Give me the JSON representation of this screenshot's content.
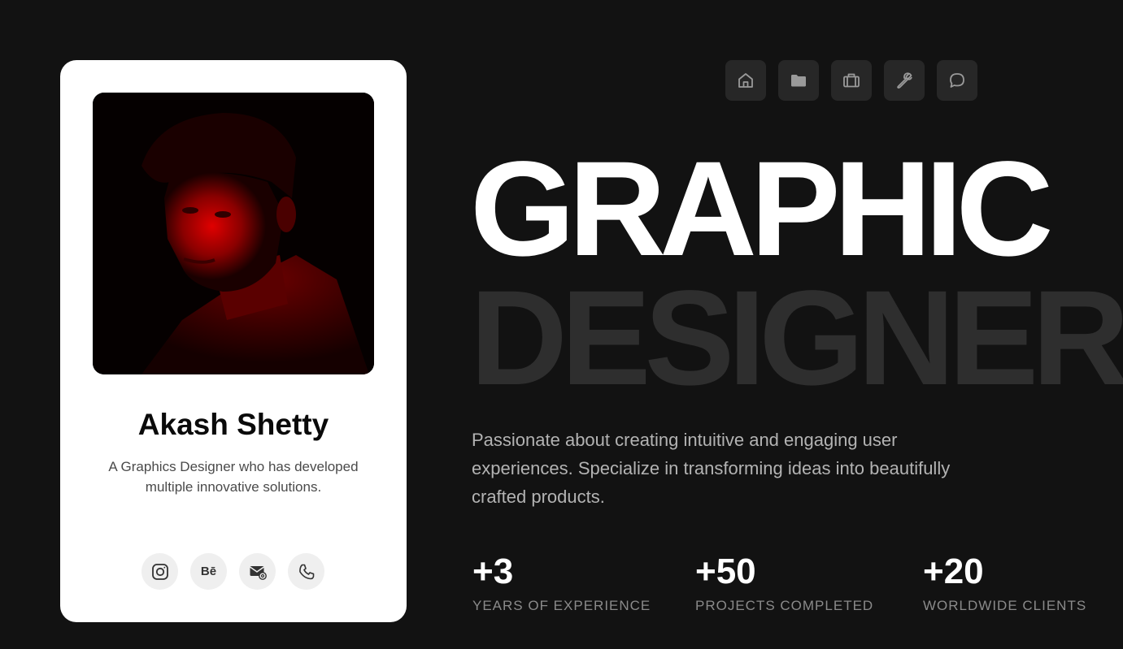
{
  "profile": {
    "name": "Akash Shetty",
    "bio": "A Graphics Designer who has developed multiple innovative solutions.",
    "socials": [
      {
        "icon": "instagram-icon"
      },
      {
        "icon": "behance-icon",
        "label": "Bē"
      },
      {
        "icon": "mail-icon"
      },
      {
        "icon": "phone-icon"
      }
    ]
  },
  "nav": {
    "items": [
      {
        "icon": "home-icon"
      },
      {
        "icon": "folder-icon"
      },
      {
        "icon": "briefcase-icon"
      },
      {
        "icon": "wrench-icon"
      },
      {
        "icon": "chat-icon"
      }
    ]
  },
  "hero": {
    "line1": "GRAPHIC",
    "line2": "DESIGNER",
    "intro": "Passionate about creating intuitive and engaging user experiences. Specialize in transforming ideas into beautifully crafted products."
  },
  "stats": [
    {
      "value": "+3",
      "label": "YEARS OF EXPERIENCE"
    },
    {
      "value": "+50",
      "label": "PROJECTS COMPLETED"
    },
    {
      "value": "+20",
      "label": "WORLDWIDE CLIENTS"
    }
  ],
  "colors": {
    "background": "#121212",
    "card": "#ffffff",
    "accent_dim": "#2e2e2e",
    "text_muted": "#b3b3b3"
  }
}
